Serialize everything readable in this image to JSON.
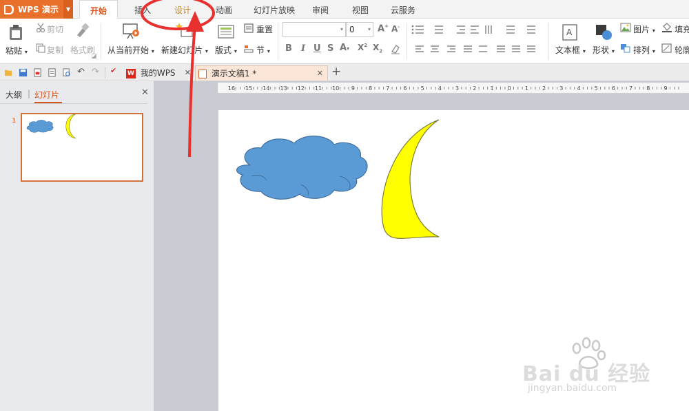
{
  "app": {
    "title": "WPS 演示"
  },
  "menu_tabs": [
    "开始",
    "插入",
    "设计",
    "动画",
    "幻灯片放映",
    "审阅",
    "视图",
    "云服务"
  ],
  "ribbon": {
    "paste": "粘贴",
    "cut": "剪切",
    "copy": "复制",
    "format_painter": "格式刷",
    "from_current": "从当前开始",
    "new_slide": "新建幻灯片",
    "layout": "版式",
    "reset": "重置",
    "section": "节",
    "font_size": "0",
    "textbox": "文本框",
    "shape": "形状",
    "picture": "图片",
    "arrange": "排列",
    "fill": "填充",
    "outline": "轮廓"
  },
  "doc_tabs": {
    "mywps": "我的WPS",
    "document": "演示文稿1 *"
  },
  "left_panel": {
    "outline_tab": "大纲",
    "slides_tab": "幻灯片",
    "slide_number": "1"
  },
  "ruler_ticks": [
    "16",
    "15",
    "14",
    "13",
    "12",
    "11",
    "10",
    "9",
    "8",
    "7",
    "6",
    "5",
    "4",
    "3",
    "2",
    "1",
    "0",
    "1",
    "2",
    "3",
    "4",
    "5",
    "6",
    "7",
    "8",
    "9"
  ],
  "watermark": {
    "brand": "Bai du 经验",
    "url": "jingyan.baidu.com"
  },
  "colors": {
    "accent": "#e8702a",
    "cloud": "#5b9bd5",
    "moon": "#ffff00",
    "annotation": "#e8312f"
  }
}
